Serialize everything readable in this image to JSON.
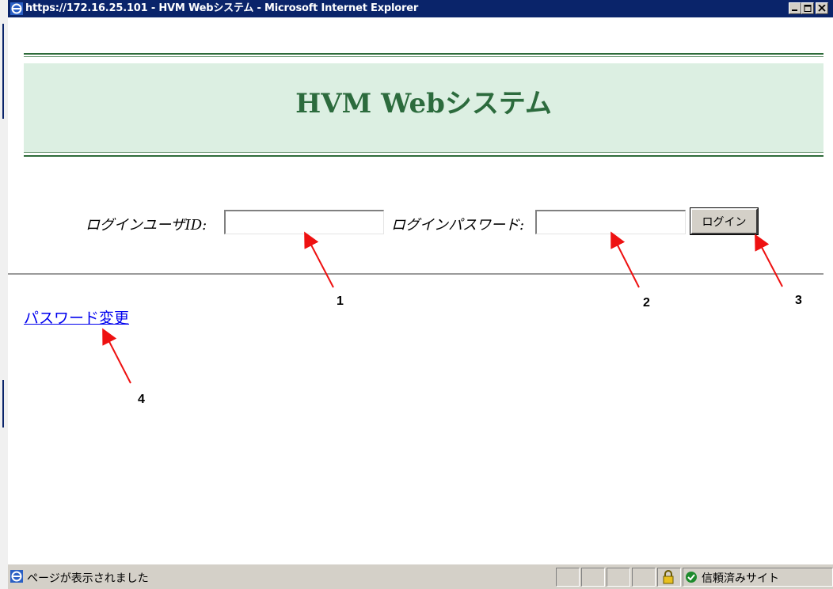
{
  "window": {
    "title": "https://172.16.25.101 - HVM Webシステム - Microsoft Internet Explorer"
  },
  "page": {
    "banner_title": "HVM Webシステム",
    "login": {
      "user_id_label": "ログインユーザID:",
      "user_id_value": "",
      "password_label": "ログインパスワード:",
      "password_value": "",
      "login_button": "ログイン"
    },
    "change_password_link": "パスワード変更"
  },
  "annotations": {
    "labels": [
      "1",
      "2",
      "3",
      "4"
    ],
    "arrow_color": "#ee1111"
  },
  "statusbar": {
    "status_text": "ページが表示されました",
    "zone_text": "信頼済みサイト"
  },
  "colors": {
    "titlebar": "#0a246a",
    "banner_bg": "#dcefe2",
    "banner_text": "#2c6b3d",
    "link": "#0000ee"
  }
}
